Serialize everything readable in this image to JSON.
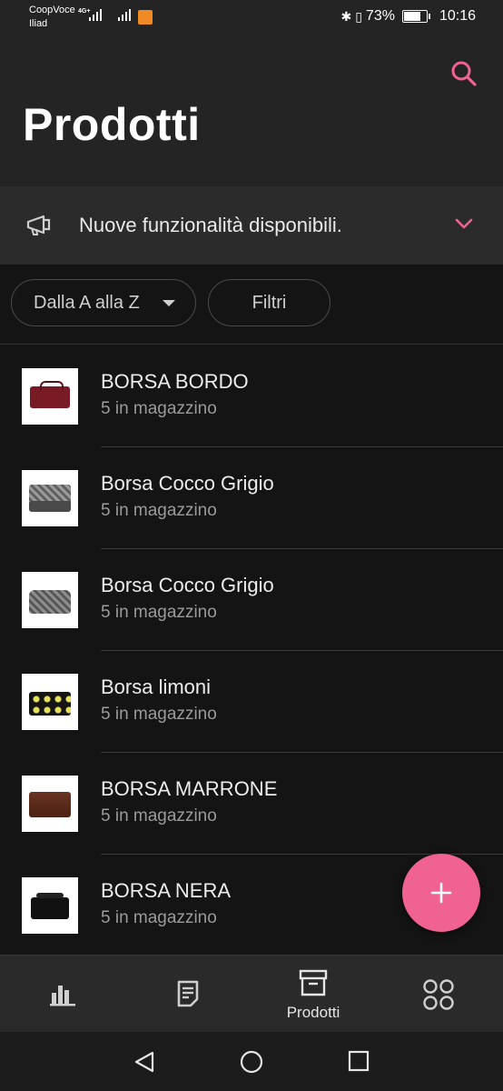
{
  "status_bar": {
    "carrier_1": "CoopVoce",
    "carrier_2": "Iliad",
    "network_type": "4G+",
    "battery": "73%",
    "time": "10:16"
  },
  "header": {
    "title": "Prodotti",
    "search_icon": "search-icon"
  },
  "banner": {
    "icon": "megaphone-icon",
    "text": "Nuove funzionalità disponibili.",
    "expand_icon": "chevron-down-icon"
  },
  "filters": {
    "sort_label": "Dalla A alla Z",
    "filter_label": "Filtri"
  },
  "products": [
    {
      "name": "BORSA BORDO",
      "stock": "5 in magazzino",
      "color": "#7a1a24"
    },
    {
      "name": "Borsa Cocco Grigio",
      "stock": "5 in magazzino",
      "color": "#8a8a8a"
    },
    {
      "name": "Borsa Cocco Grigio",
      "stock": "5 in magazzino",
      "color": "#7d7d7d"
    },
    {
      "name": "Borsa limoni",
      "stock": "5 in magazzino",
      "color": "#151515"
    },
    {
      "name": "BORSA MARRONE",
      "stock": "5 in magazzino",
      "color": "#5a2a1a"
    },
    {
      "name": "BORSA NERA",
      "stock": "5 in magazzino",
      "color": "#111111"
    }
  ],
  "fab": {
    "icon": "plus-icon"
  },
  "bottom_nav": [
    {
      "id": "stats",
      "icon": "bar-chart-icon",
      "label": ""
    },
    {
      "id": "orders",
      "icon": "document-icon",
      "label": ""
    },
    {
      "id": "products",
      "icon": "archive-box-icon",
      "label": "Prodotti",
      "active": true
    },
    {
      "id": "more",
      "icon": "apps-grid-icon",
      "label": ""
    }
  ],
  "system_nav": [
    "back-icon",
    "home-icon",
    "recents-icon"
  ],
  "colors": {
    "accent": "#f06292",
    "background": "#141414",
    "surface": "#242424"
  }
}
